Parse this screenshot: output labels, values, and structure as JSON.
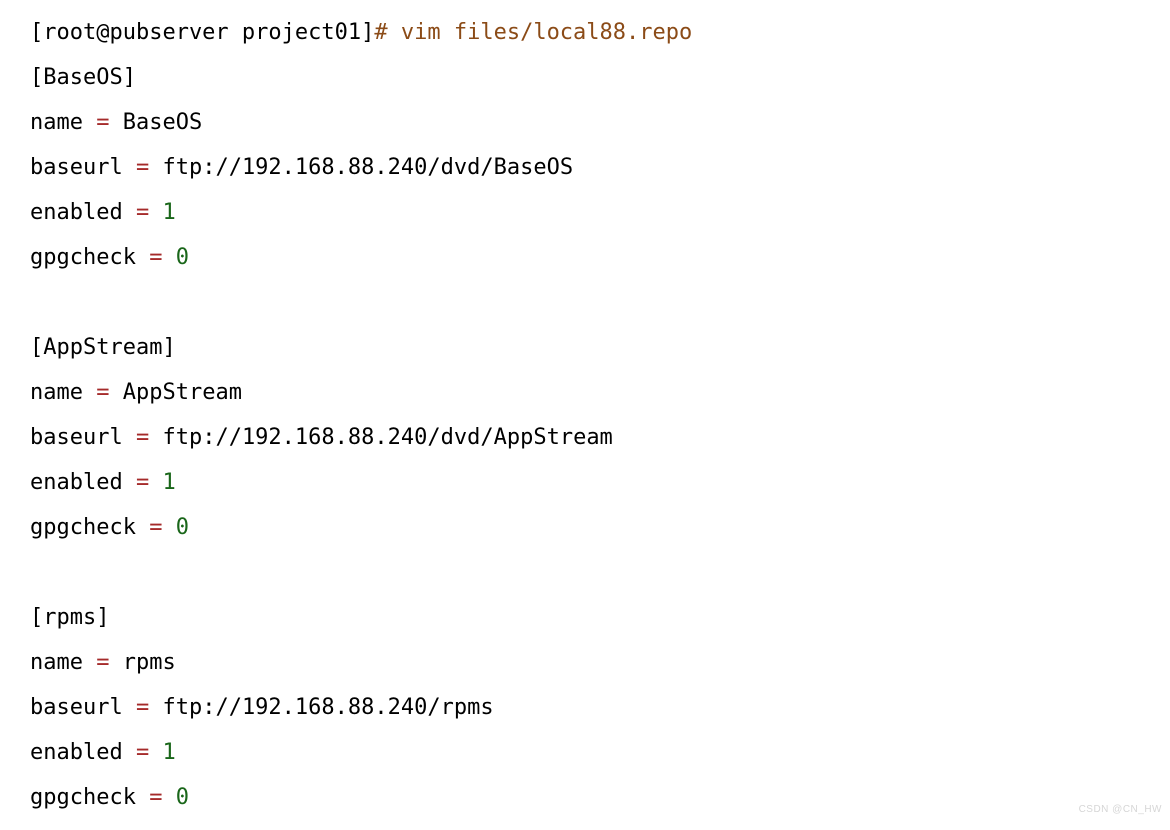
{
  "prompt": "[root@pubserver project01]",
  "hash": "#",
  "command": " vim files/local88.repo",
  "sections": {
    "baseos": {
      "header": "[BaseOS]",
      "name_key": "name",
      "name_val": "BaseOS",
      "baseurl_key": "baseurl",
      "baseurl_val": "ftp://192.168.88.240/dvd/BaseOS",
      "enabled_key": "enabled",
      "enabled_val": "1",
      "gpgcheck_key": "gpgcheck",
      "gpgcheck_val": "0"
    },
    "appstream": {
      "header": "[AppStream]",
      "name_key": "name",
      "name_val": "AppStream",
      "baseurl_key": "baseurl",
      "baseurl_val": "ftp://192.168.88.240/dvd/AppStream",
      "enabled_key": "enabled",
      "enabled_val": "1",
      "gpgcheck_key": "gpgcheck",
      "gpgcheck_val": "0"
    },
    "rpms": {
      "header": "[rpms]",
      "name_key": "name",
      "name_val": "rpms",
      "baseurl_key": "baseurl",
      "baseurl_val": "ftp://192.168.88.240/rpms",
      "enabled_key": "enabled",
      "enabled_val": "1",
      "gpgcheck_key": "gpgcheck",
      "gpgcheck_val": "0"
    }
  },
  "eq": " = ",
  "watermark": "CSDN @CN_HW"
}
